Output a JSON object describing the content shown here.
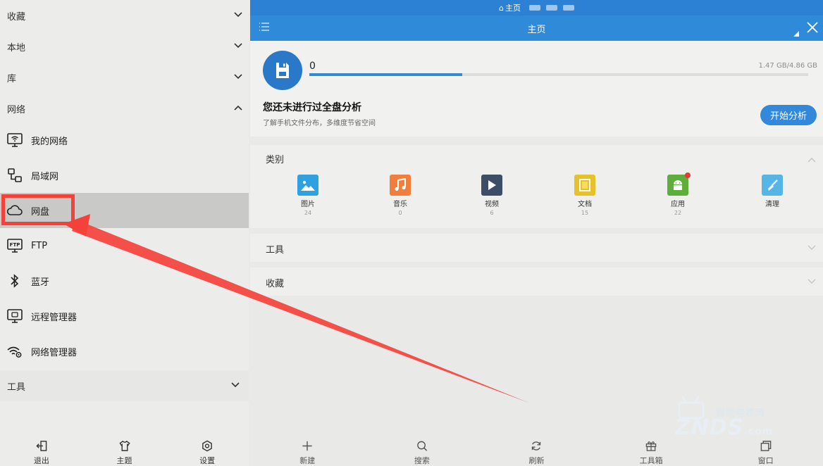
{
  "drawer": {
    "sections": [
      {
        "label": "收藏"
      },
      {
        "label": "本地"
      },
      {
        "label": "库"
      },
      {
        "label": "网络"
      }
    ],
    "network_items": [
      {
        "label": "我的网络",
        "icon": "monitor-wifi-icon"
      },
      {
        "label": "局域网",
        "icon": "lan-icon"
      },
      {
        "label": "网盘",
        "icon": "cloud-icon"
      },
      {
        "label": "FTP",
        "icon": "ftp-icon"
      },
      {
        "label": "蓝牙",
        "icon": "bluetooth-icon"
      },
      {
        "label": "远程管理器",
        "icon": "remote-manager-icon"
      },
      {
        "label": "网络管理器",
        "icon": "network-manager-icon"
      }
    ],
    "tools_label": "工具",
    "bottom": [
      {
        "label": "退出",
        "icon": "exit-icon"
      },
      {
        "label": "主题",
        "icon": "theme-shirt-icon"
      },
      {
        "label": "设置",
        "icon": "gear-icon"
      }
    ]
  },
  "status_bar": {
    "title": "主页"
  },
  "appbar": {
    "title": "主页"
  },
  "storage": {
    "used": "0",
    "capacity": "1.47 GB/4.86 GB",
    "fill_fraction": 0.307,
    "analysis_title": "您还未进行过全盘分析",
    "analysis_subtitle": "了解手机文件分布，多维度节省空间",
    "analyze_button": "开始分析"
  },
  "categories": {
    "title": "类别",
    "items": [
      {
        "label": "图片",
        "count": "24",
        "icon": "image-icon",
        "color": "#2fa0e0"
      },
      {
        "label": "音乐",
        "count": "0",
        "icon": "music-icon",
        "color": "#f27e3d"
      },
      {
        "label": "视频",
        "count": "6",
        "icon": "video-play-icon",
        "color": "#3e4d66"
      },
      {
        "label": "文档",
        "count": "15",
        "icon": "document-icon",
        "color": "#e5c229"
      },
      {
        "label": "应用",
        "count": "22",
        "icon": "android-icon",
        "color": "#5fae3c"
      },
      {
        "label": "清理",
        "count": "",
        "icon": "broom-icon",
        "color": "#55b5e5"
      }
    ]
  },
  "panels": {
    "tools": "工具",
    "favorites": "收藏"
  },
  "main_bottom": [
    {
      "label": "新建",
      "icon": "plus-icon"
    },
    {
      "label": "搜索",
      "icon": "search-icon"
    },
    {
      "label": "刷新",
      "icon": "refresh-icon"
    },
    {
      "label": "工具箱",
      "icon": "toolbox-gift-icon"
    },
    {
      "label": "窗口",
      "icon": "windows-icon"
    }
  ],
  "watermark": {
    "cn": "智能电视网",
    "en": "ZNDS",
    "suffix": ".com"
  },
  "colors": {
    "accent": "#2f8ada",
    "highlight": "#f4423b"
  }
}
